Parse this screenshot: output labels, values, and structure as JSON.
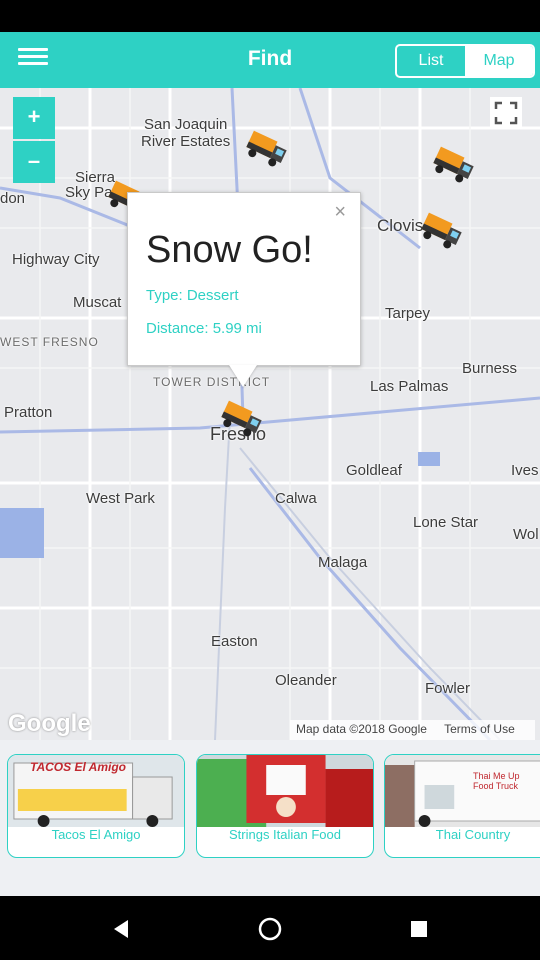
{
  "header": {
    "title": "Find",
    "segments": [
      "List",
      "Map"
    ],
    "active_segment": "Map"
  },
  "map": {
    "zoom_in": "+",
    "zoom_out": "–",
    "places": [
      "San Joaquin",
      "River Estates",
      "Sierra",
      "Sky Pa",
      "don",
      "Clovis",
      "Highway City",
      "Muscat",
      "WEST FRESNO",
      "Tarpey",
      "Burness",
      "TOWER DISTRICT",
      "Las Palmas",
      "Pratton",
      "Fresno",
      "Goldleaf",
      "Ives",
      "West Park",
      "Calwa",
      "Lone Star",
      "Wol",
      "Malaga",
      "Easton",
      "Oleander",
      "Fowler"
    ],
    "logo": "Google",
    "attribution": [
      "Map data ©2018 Google",
      "Terms of Use"
    ]
  },
  "popup": {
    "title": "Snow Go!",
    "type": "Type: Dessert",
    "distance": "Distance: 5.99 mi",
    "close": "×"
  },
  "cards": [
    {
      "name": "Tacos El Amigo",
      "sign": "TACOS El Amigo"
    },
    {
      "name": "Strings Italian Food",
      "sign": ""
    },
    {
      "name": "Thai Country",
      "sign": "Thai Me Up Food Truck"
    }
  ],
  "colors": {
    "accent": "#2ed1c4",
    "truck_orange": "#f29a1f"
  }
}
